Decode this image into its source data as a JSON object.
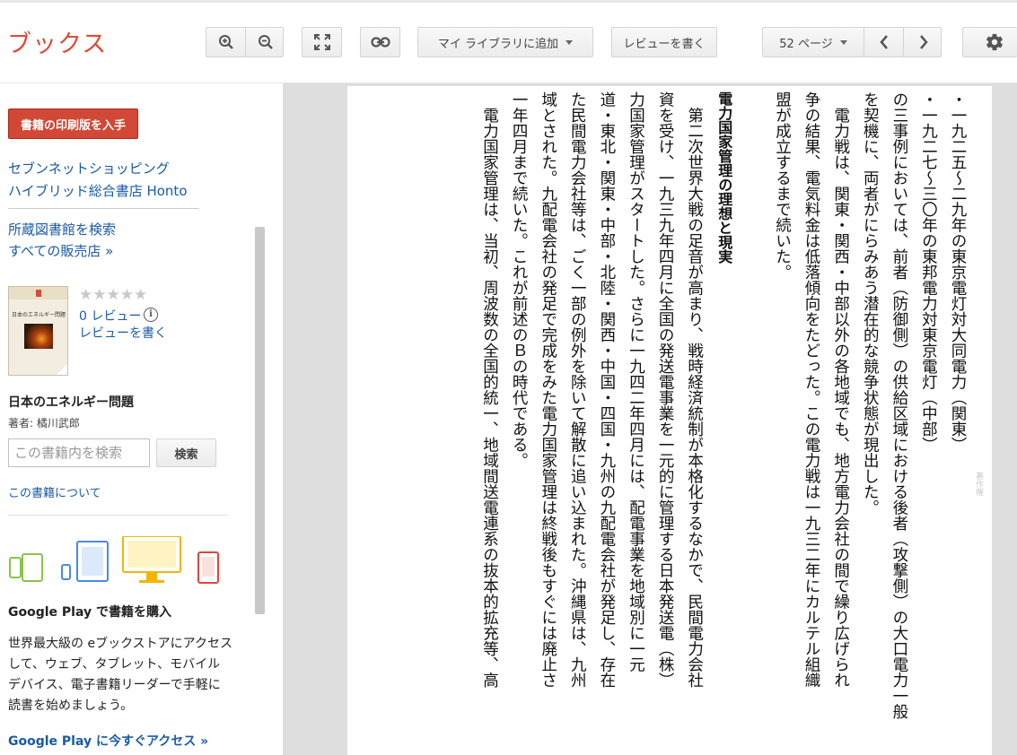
{
  "app": {
    "logo": "ブックス"
  },
  "toolbar": {
    "add_library": "マイ ライブラリに追加",
    "write_review": "レビューを書く",
    "page_select": "52 ページ"
  },
  "sidebar": {
    "buy_print": "書籍の印刷版を入手",
    "stores": [
      "セブンネットショッピング",
      "ハイブリッド総合書店 Honto"
    ],
    "find_library": "所蔵図書館を検索",
    "all_sellers": "すべての販売店 »",
    "cover_title": "日本のエネルギー問題",
    "rating": "★★★★★",
    "reviews_count": "0 レビュー",
    "write_review": "レビューを書く",
    "book_title": "日本のエネルギー問題",
    "author": "著者: 橘川武郎",
    "search_placeholder": "この書籍内を検索",
    "search_button": "検索",
    "about": "この書籍について",
    "gp_title": "Google Play で書籍を購入",
    "gp_desc": "世界最大級の eブックストアにアクセスして、ウェブ、タブレット、モバイルデバイス、電子書籍リーダーで手軽に読書を始めましょう。",
    "gp_link": "Google Play に今すぐアクセス »"
  },
  "page": {
    "lines": [
      "・一九二五～二九年の東京電灯対大同電力（関東）",
      "・一九二七～三〇年の東邦電力対東京電灯（中部）",
      "の三事例においては、前者（防御側）の供給区域における後者（攻撃側）の大口電力一般",
      "を契機に、両者がにらみあう潜在的な競争状態が現出した。",
      "　電力戦は、関東・関西・中部以外の各地域でも、地方電力会社の間で繰り広げられ",
      "争の結果、電気料金は低落傾向をたどった。この電力戦は一九三二年にカルテル組織",
      "盟が成立するまで続いた。",
      "",
      "電力国家管理の理想と現実",
      "　第二次世界大戦の足音が高まり、戦時経済統制が本格化するなかで、民間電力会社",
      "資を受け、一九三九年四月に全国の発送電事業を一元的に管理する日本発送電（株）",
      "力国家管理がスタートした。さらに一九四二年四月には、配電事業を地域別に一元",
      "道・東北・関東・中部・北陸・関西・中国・四国・九州の九配電会社が発足し、存在",
      "た民間電力会社等は、ごく一部の例外を除いて解散に追い込まれた。沖縄県は、九州",
      "域とされた。九配電会社の発足で完成をみた電力国家管理は終戦後もすぐには廃止さ",
      "一年四月まで続いた。これが前述のＢの時代である。",
      "　電力国家管理は、当初、周波数の全国的統一、地域間送電連系の抜本的拡充等、高"
    ],
    "heading_index": 8,
    "watermark": "著作権"
  }
}
